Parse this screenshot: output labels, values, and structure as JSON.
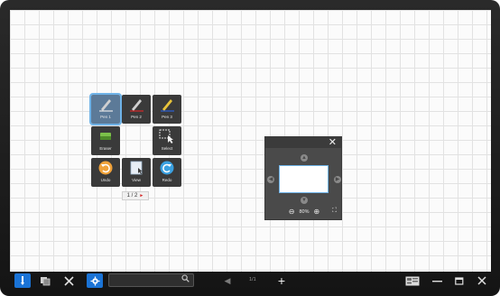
{
  "palette": {
    "tools": [
      {
        "label": "Pen 1",
        "icon": "pen-icon"
      },
      {
        "label": "Pen 2",
        "icon": "pen-icon"
      },
      {
        "label": "Pen 3",
        "icon": "pen-icon"
      },
      {
        "label": "Eraser",
        "icon": "eraser-icon"
      },
      {
        "label": "Select",
        "icon": "select-icon"
      },
      {
        "label": "Undo",
        "icon": "undo-icon"
      },
      {
        "label": "View",
        "icon": "view-icon"
      },
      {
        "label": "Redo",
        "icon": "redo-icon"
      }
    ],
    "page_indicator": "1 / 2",
    "page_arrow": "►"
  },
  "navigator": {
    "close": "✕",
    "zoom_out": "⊖",
    "zoom_value": "80%",
    "zoom_in": "⊕",
    "fit": "⛶"
  },
  "toolbar": {
    "search_placeholder": "",
    "search_icon": "🔍",
    "prev_page": "◀",
    "page_label": "1/1",
    "add_page": "+"
  },
  "colors": {
    "accent": "#1a73d6",
    "selection": "#6fb3e8",
    "undo": "#f0a23a",
    "redo": "#3aa0e0",
    "pen2_line": "#d62828",
    "pen3_line": "#2b5fd6"
  }
}
